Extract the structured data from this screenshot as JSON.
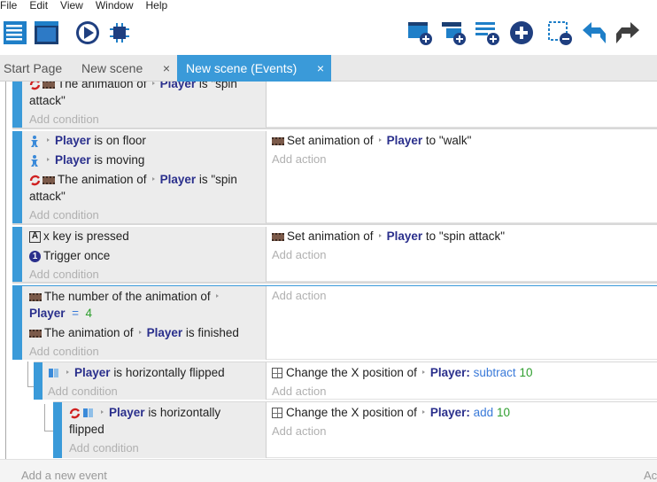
{
  "menu": [
    "File",
    "Edit",
    "View",
    "Window",
    "Help"
  ],
  "tabs": [
    {
      "label": "Start Page",
      "closable": false,
      "active": false
    },
    {
      "label": "New scene",
      "closable": true,
      "active": false
    },
    {
      "label": "New scene (Events)",
      "closable": true,
      "active": true
    }
  ],
  "close_glyph": "×",
  "toolbar_left": [
    "project-manager-icon",
    "scene-editor-icon",
    "preview-play-icon",
    "debugger-icon"
  ],
  "toolbar_right": [
    "add-event-icon",
    "add-sub-event-icon",
    "add-comment-icon",
    "add-more-icon",
    "delete-icon",
    "undo-icon",
    "redo-icon"
  ],
  "events": {
    "e1": {
      "c1_a": "The animation of",
      "c1_obj": "Player",
      "c1_b": "is \"spin",
      "c1_c": "attack\"",
      "add_condition": "Add condition"
    },
    "e2": {
      "c1_obj": "Player",
      "c1_b": "is on floor",
      "c2_obj": "Player",
      "c2_b": "is moving",
      "c3_a": "The animation of",
      "c3_obj": "Player",
      "c3_b": "is \"spin",
      "c3_c": "attack\"",
      "add_condition": "Add condition",
      "a1_a": "Set animation of",
      "a1_obj": "Player",
      "a1_b": "to \"walk\"",
      "add_action": "Add action"
    },
    "e3": {
      "c1_a": "x key is pressed",
      "c2_a": "Trigger once",
      "add_condition": "Add condition",
      "a1_a": "Set animation of",
      "a1_obj": "Player",
      "a1_b": "to \"spin attack\"",
      "add_action": "Add action"
    },
    "e4": {
      "c1_a": "The number of the animation of",
      "c1_obj": "Player",
      "c1_op": "=",
      "c1_num": "4",
      "c2_a": "The animation of",
      "c2_obj": "Player",
      "c2_b": "is finished",
      "add_condition": "Add condition",
      "add_action": "Add action"
    },
    "e5": {
      "c1_obj": "Player",
      "c1_b": "is horizontally flipped",
      "add_condition": "Add condition",
      "a1_a": "Change the X position of",
      "a1_obj": "Player:",
      "a1_op": "subtract",
      "a1_num": "10",
      "add_action": "Add action"
    },
    "e6": {
      "c1_obj": "Player",
      "c1_b": "is horizontally",
      "c1_c": "flipped",
      "add_condition": "Add condition",
      "a1_a": "Change the X position of",
      "a1_obj": "Player:",
      "a1_op": "add",
      "a1_num": "10",
      "add_action": "Add action"
    }
  },
  "add_new_event": "Add a new event",
  "add_new_right": "Ac",
  "colors": {
    "accent": "#3a9ad9",
    "object": "#2a2f8c",
    "number": "#2e9e2e",
    "operator": "#3a7ad9"
  }
}
